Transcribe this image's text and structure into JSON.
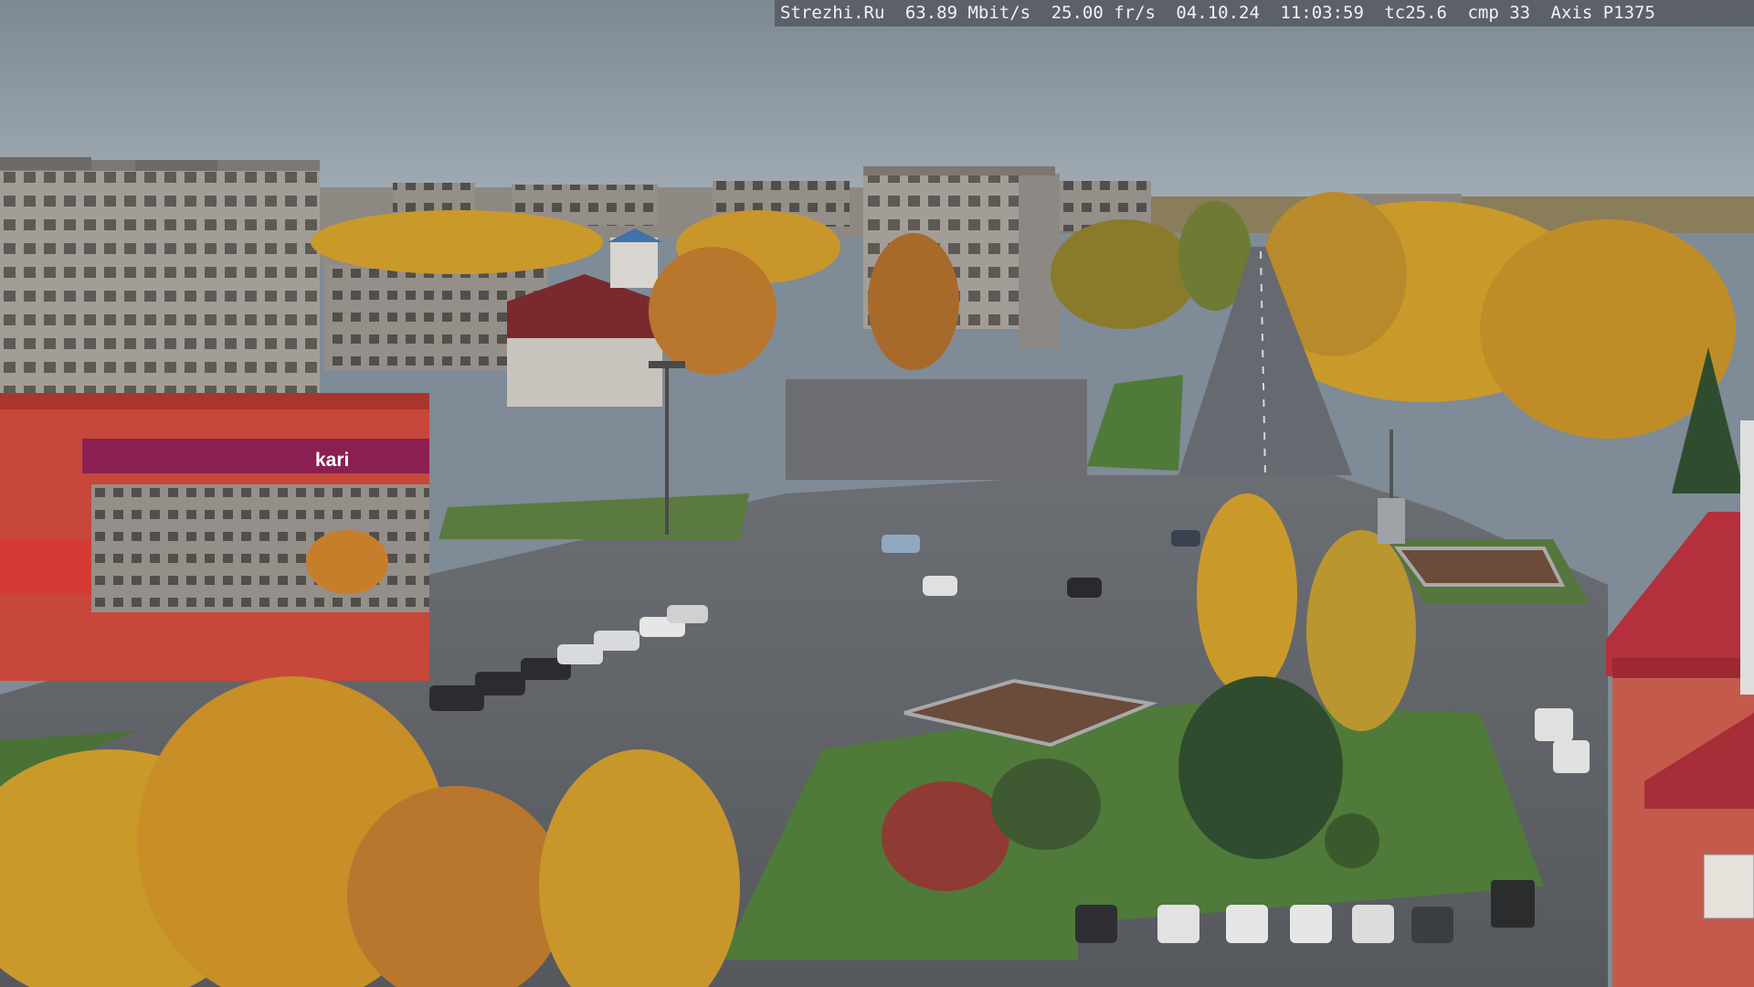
{
  "camera_overlay": {
    "site": "Strezhi.Ru",
    "bitrate": "63.89 Mbit/s",
    "framerate": "25.00 fr/s",
    "date": "04.10.24",
    "time": "11:03:59",
    "tc": "tc25.6",
    "cmp": "cmp 33",
    "camera_model": "Axis P1375"
  },
  "storefront_sign": {
    "brand": "kari"
  },
  "colors": {
    "sky": "#8d98a2",
    "asphalt": "#5e6166",
    "foliage_yellow": "#c99a2a",
    "foliage_orange": "#c77e2a",
    "building_gray": "#9c9690",
    "storefront_red": "#c7473a",
    "roof_maroon": "#7a2a2e",
    "grass": "#4f7a3a",
    "overlay_bg": "#5b6069"
  }
}
